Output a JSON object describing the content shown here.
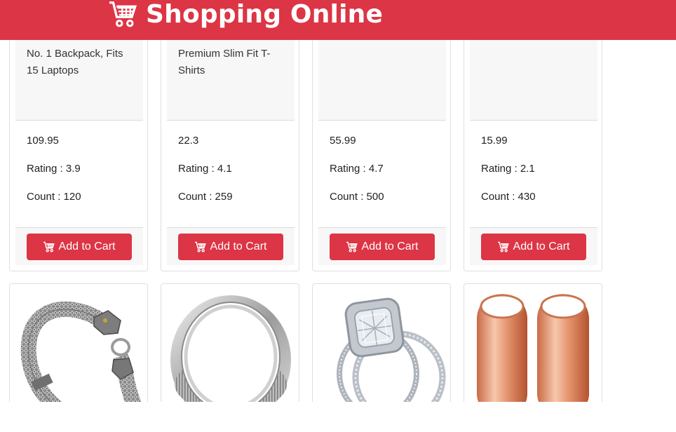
{
  "header": {
    "title": "Shopping Online",
    "icon": "cart-icon",
    "background": "#dc3545"
  },
  "products": [
    {
      "title": "No. 1 Backpack, Fits 15 Laptops",
      "price": "109.95",
      "rating": "Rating : 3.9",
      "count": "Count : 120",
      "button": "Add to Cart"
    },
    {
      "title": "Premium Slim Fit T-Shirts",
      "price": "22.3",
      "rating": "Rating : 4.1",
      "count": "Count : 259",
      "button": "Add to Cart"
    },
    {
      "title": "",
      "price": "55.99",
      "rating": "Rating : 4.7",
      "count": "Count : 500",
      "button": "Add to Cart"
    },
    {
      "title": "",
      "price": "15.99",
      "rating": "Rating : 2.1",
      "count": "Count : 430",
      "button": "Add to Cart"
    }
  ],
  "next_row": [
    {
      "image": "silver-dragon-bracelet-image"
    },
    {
      "image": "silver-ring-image"
    },
    {
      "image": "diamond-ring-set-image"
    },
    {
      "image": "rose-gold-tunnel-plugs-image"
    }
  ]
}
